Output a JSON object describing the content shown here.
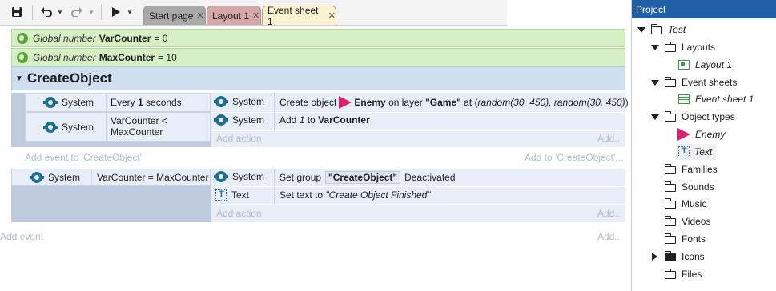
{
  "toolbar": {
    "icons": [
      "save-icon",
      "undo-icon",
      "redo-icon",
      "run-icon"
    ],
    "tabs": [
      {
        "label": "Start page"
      },
      {
        "label": "Layout 1"
      },
      {
        "label": "Event sheet 1"
      }
    ],
    "close_glyph": "✕"
  },
  "globals": [
    {
      "keyword": "Global number",
      "name": "VarCounter",
      "value": "= 0"
    },
    {
      "keyword": "Global number",
      "name": "MaxCounter",
      "value": "= 10"
    }
  ],
  "group": {
    "title": "CreateObject",
    "event1": {
      "conditions": [
        {
          "object": "System",
          "pre": "Every ",
          "strong": "1",
          "post": " seconds"
        },
        {
          "object": "System",
          "line1": "VarCounter <",
          "line2": "MaxCounter"
        }
      ],
      "actions": [
        {
          "object": "System",
          "pre": "Create object",
          "obj": "Enemy",
          "mid": " on layer ",
          "layer": "\"Game\"",
          "at": " at (",
          "args": "random(30, 450), random(30, 450)",
          "close": ")"
        },
        {
          "object": "System",
          "pre": "Add ",
          "num": "1",
          "mid": " to ",
          "var": "VarCounter"
        }
      ],
      "add_action": "Add action",
      "add_short": "Add..."
    },
    "add_event": "Add event to 'CreateObject'",
    "add_to": "Add to 'CreateObject'..."
  },
  "event2": {
    "condition": {
      "object": "System",
      "text": "VarCounter = MaxCounter"
    },
    "actions": [
      {
        "object": "System",
        "pre": "Set group",
        "chip": "\"CreateObject\"",
        "post": "Deactivated"
      },
      {
        "object": "Text",
        "pre": "Set text to ",
        "value": "\"Create Object Finished\""
      }
    ],
    "add_action": "Add action",
    "add_short": "Add..."
  },
  "footer": {
    "add_event": "Add event",
    "add_short": "Add..."
  },
  "project": {
    "header": "Project",
    "items": [
      {
        "label": "Test"
      },
      {
        "label": "Layouts"
      },
      {
        "label": "Layout 1"
      },
      {
        "label": "Event sheets"
      },
      {
        "label": "Event sheet 1"
      },
      {
        "label": "Object types"
      },
      {
        "label": "Enemy"
      },
      {
        "label": "Text"
      },
      {
        "label": "Families"
      },
      {
        "label": "Sounds"
      },
      {
        "label": "Music"
      },
      {
        "label": "Videos"
      },
      {
        "label": "Fonts"
      },
      {
        "label": "Icons"
      },
      {
        "label": "Files"
      }
    ]
  },
  "colors": {
    "accent": "#1f5fa6",
    "enemy_pink": "#e0206f",
    "global_green": "#d6efc4",
    "group_blue": "#cfdff0"
  }
}
